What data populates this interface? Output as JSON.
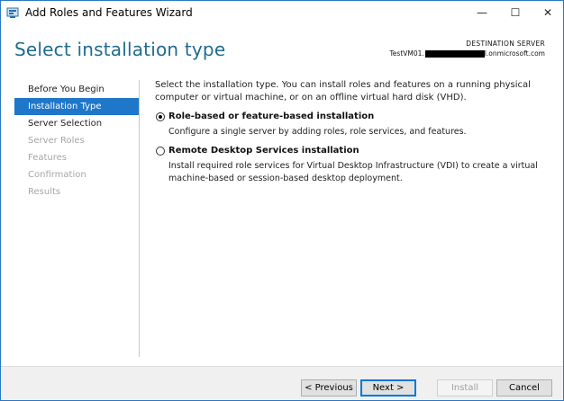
{
  "window": {
    "title": "Add Roles and Features Wizard",
    "minimize_glyph": "—",
    "maximize_glyph": "☐",
    "close_glyph": "✕"
  },
  "header": {
    "title": "Select installation type",
    "destination_label": "DESTINATION SERVER",
    "destination_prefix": "TestVM01.",
    "destination_suffix": "l.onmicrosoft.com"
  },
  "nav": {
    "items": [
      {
        "label": "Before You Begin",
        "state": "normal"
      },
      {
        "label": "Installation Type",
        "state": "active"
      },
      {
        "label": "Server Selection",
        "state": "normal"
      },
      {
        "label": "Server Roles",
        "state": "disabled"
      },
      {
        "label": "Features",
        "state": "disabled"
      },
      {
        "label": "Confirmation",
        "state": "disabled"
      },
      {
        "label": "Results",
        "state": "disabled"
      }
    ]
  },
  "content": {
    "intro": "Select the installation type. You can install roles and features on a running physical computer or virtual machine, or on an offline virtual hard disk (VHD).",
    "options": [
      {
        "label": "Role-based or feature-based installation",
        "description": "Configure a single server by adding roles, role services, and features.",
        "selected": true
      },
      {
        "label": "Remote Desktop Services installation",
        "description": "Install required role services for Virtual Desktop Infrastructure (VDI) to create a virtual machine-based or session-based desktop deployment.",
        "selected": false
      }
    ]
  },
  "footer": {
    "previous_label": "< Previous",
    "next_label": "Next >",
    "install_label": "Install",
    "cancel_label": "Cancel"
  },
  "colors": {
    "accent": "#1e77c8",
    "title_blue": "#1f6b8f",
    "disabled_text": "#a6a6a6"
  },
  "icons": {
    "app": "server-manager-icon"
  }
}
